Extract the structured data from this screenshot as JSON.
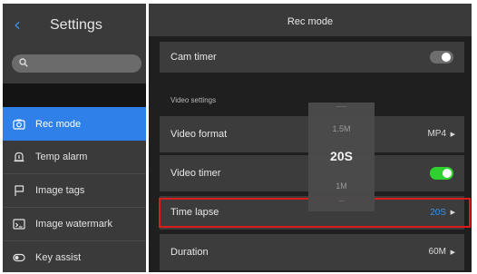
{
  "sidebar": {
    "title": "Settings",
    "items": [
      {
        "label": "Rec mode",
        "icon": "camera-icon",
        "active": true
      },
      {
        "label": "Temp alarm",
        "icon": "alarm-icon",
        "active": false
      },
      {
        "label": "Image tags",
        "icon": "flag-icon",
        "active": false
      },
      {
        "label": "Image watermark",
        "icon": "watermark-icon",
        "active": false
      },
      {
        "label": "Key assist",
        "icon": "key-assist-icon",
        "active": false
      }
    ]
  },
  "main": {
    "title": "Rec mode",
    "cam_timer": {
      "label": "Cam timer",
      "enabled": false
    },
    "section_label": "Video settings",
    "video_format": {
      "label": "Video format",
      "value": "MP4"
    },
    "video_timer": {
      "label": "Video timer",
      "enabled": true
    },
    "time_lapse": {
      "label": "Time lapse",
      "value": "20S"
    },
    "duration": {
      "label": "Duration",
      "value": "60M"
    }
  },
  "picker": {
    "options": [
      "1.5M",
      "20S",
      "1M"
    ],
    "selected": "20S"
  },
  "colors": {
    "accent": "#2f80e8",
    "toggle_on": "#2fd12f",
    "toggle_off": "#6e6e6e",
    "highlight": "#d91c1c"
  }
}
